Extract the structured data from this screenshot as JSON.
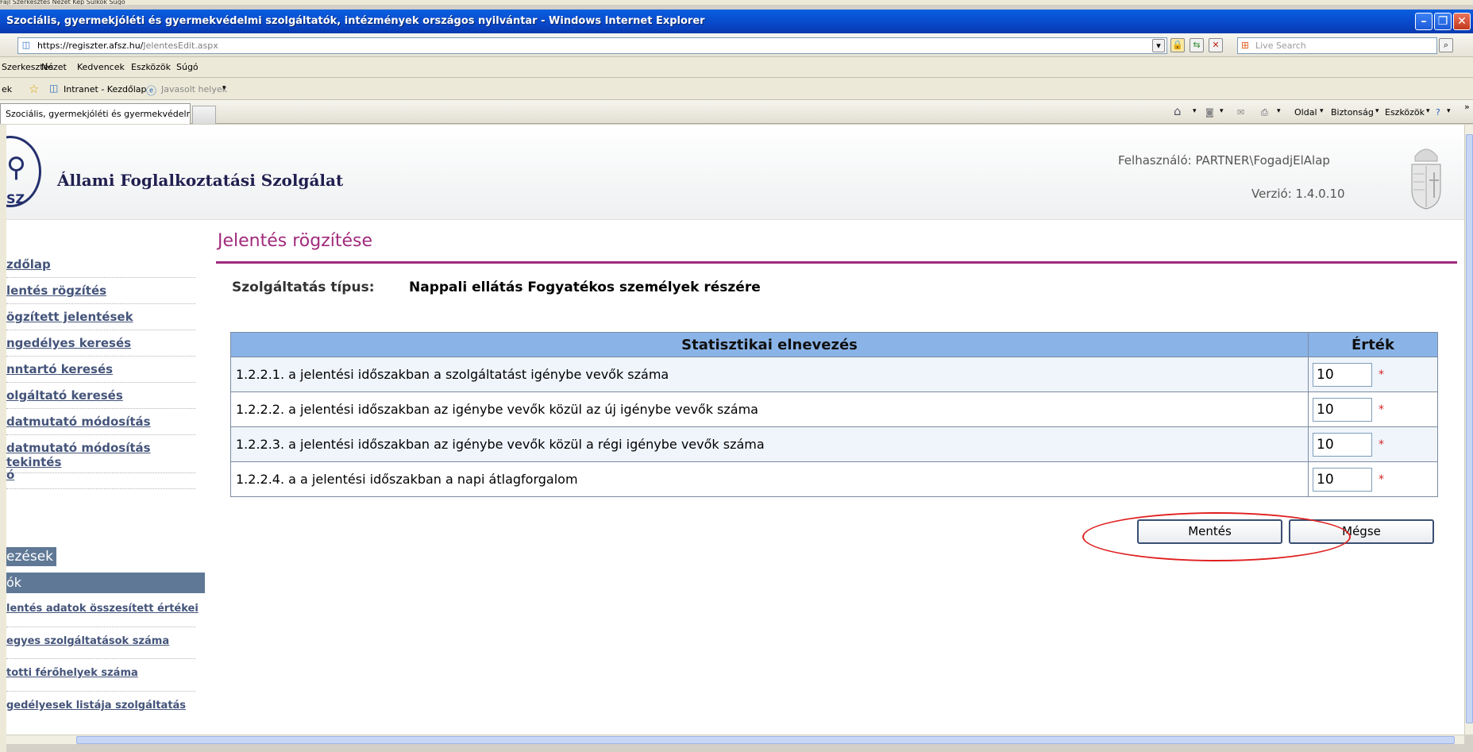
{
  "ghost": {
    "text": "Fájl   Szerkesztés   Nézet   Kép   Súlkok   Súgó"
  },
  "browser": {
    "window_title": "Szociális, gyermekjóléti és gyermekvédelmi szolgáltatók, intézmények országos nyilvántar - Windows Internet Explorer",
    "url_host": "https://regiszter.afsz.hu/",
    "url_path": "JelentesEdit.aspx",
    "search_placeholder": "Live Search",
    "menu": [
      "Szerkesztés",
      "Nézet",
      "Kedvencek",
      "Eszközök",
      "Súgó"
    ],
    "favorites": [
      "ek",
      "Intranet - Kezdőlap",
      "Javasolt helyek"
    ],
    "tab_title": "Szociális, gyermekjóléti és gyermekvédelmi szo...",
    "command_bar": [
      "Oldal",
      "Biztonság",
      "Eszközök"
    ]
  },
  "header": {
    "logo_text": "Állami Foglalkoztatási Szolgálat",
    "logo_abbr": "SZ",
    "user_label": "Felhasználó: PARTNER\\FogadjElAlap",
    "version_label": "Verzió: 1.4.0.10"
  },
  "sidebar": {
    "links": [
      "zdőlap",
      "lentés rögzítés",
      "ögzített jelentések",
      "ngedélyes keresés",
      "nntartó keresés",
      "olgáltató keresés",
      "datmutató módosítás",
      "datmutató módosítás",
      "tekintés",
      "ó"
    ],
    "section1": "ezések",
    "section2": "ók",
    "sublinks": [
      "lentés adatok összesített értékei",
      "egyes szolgáltatások száma",
      "totti férőhelyek száma",
      "gedélyesek listája szolgáltatás"
    ]
  },
  "main": {
    "title": "Jelentés rögzítése",
    "service_label": "Szolgáltatás típus:",
    "service_value": "Nappali ellátás Fogyatékos személyek részére",
    "table": {
      "headers": [
        "Statisztikai elnevezés",
        "Érték"
      ],
      "rows": [
        {
          "name": "1.2.2.1. a jelentési időszakban a szolgáltatást igénybe vevők száma",
          "value": "10"
        },
        {
          "name": "1.2.2.2. a jelentési időszakban az igénybe vevők közül az új igénybe vevők száma",
          "value": "10"
        },
        {
          "name": "1.2.2.3. a jelentési időszakban az igénybe vevők közül a régi igénybe vevők száma",
          "value": "10"
        },
        {
          "name": "1.2.2.4. a a jelentési időszakban a napi átlagforgalom",
          "value": "10"
        }
      ],
      "required_marker": "*"
    },
    "save_button": "Mentés",
    "cancel_button": "Mégse"
  },
  "colors": {
    "title_accent": "#a12a7c",
    "table_header": "#8ab4e8",
    "sidebar_link": "#44547a",
    "sidebar_section": "#5f7896",
    "annotation": "#e02020"
  }
}
